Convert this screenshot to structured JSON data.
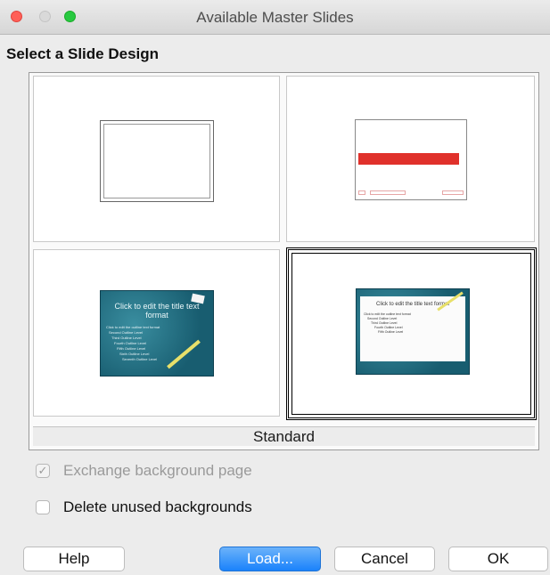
{
  "window": {
    "title": "Available Master Slides"
  },
  "heading": "Select a Slide Design",
  "gallery": {
    "caption": "Standard",
    "selected_index": 3,
    "slides": [
      {
        "kind": "blank"
      },
      {
        "kind": "red-bar"
      },
      {
        "kind": "teal",
        "title_text": "Click to edit the title text format",
        "body_lines": [
          "Click to edit the outline text format",
          "Second Outline Level",
          "Third Outline Level",
          "Fourth Outline Level",
          "Fifth Outline Level",
          "Sixth Outline Level",
          "Seventh Outline Level"
        ]
      },
      {
        "kind": "teal-light",
        "title_text": "Click to edit the title text format",
        "body_lines": [
          "Click to edit the outline text format",
          "Second Outline Level",
          "Third Outline Level",
          "Fourth Outline Level",
          "Fifth Outline Level"
        ]
      }
    ]
  },
  "options": {
    "exchange_background": {
      "label": "Exchange background page",
      "checked": true,
      "enabled": false
    },
    "delete_unused": {
      "label": "Delete unused backgrounds",
      "checked": false,
      "enabled": true
    }
  },
  "buttons": {
    "help": "Help",
    "load": "Load...",
    "cancel": "Cancel",
    "ok": "OK"
  },
  "colors": {
    "accent": "#1a82fb",
    "red_bar": "#e0312b",
    "teal": "#185d70"
  }
}
